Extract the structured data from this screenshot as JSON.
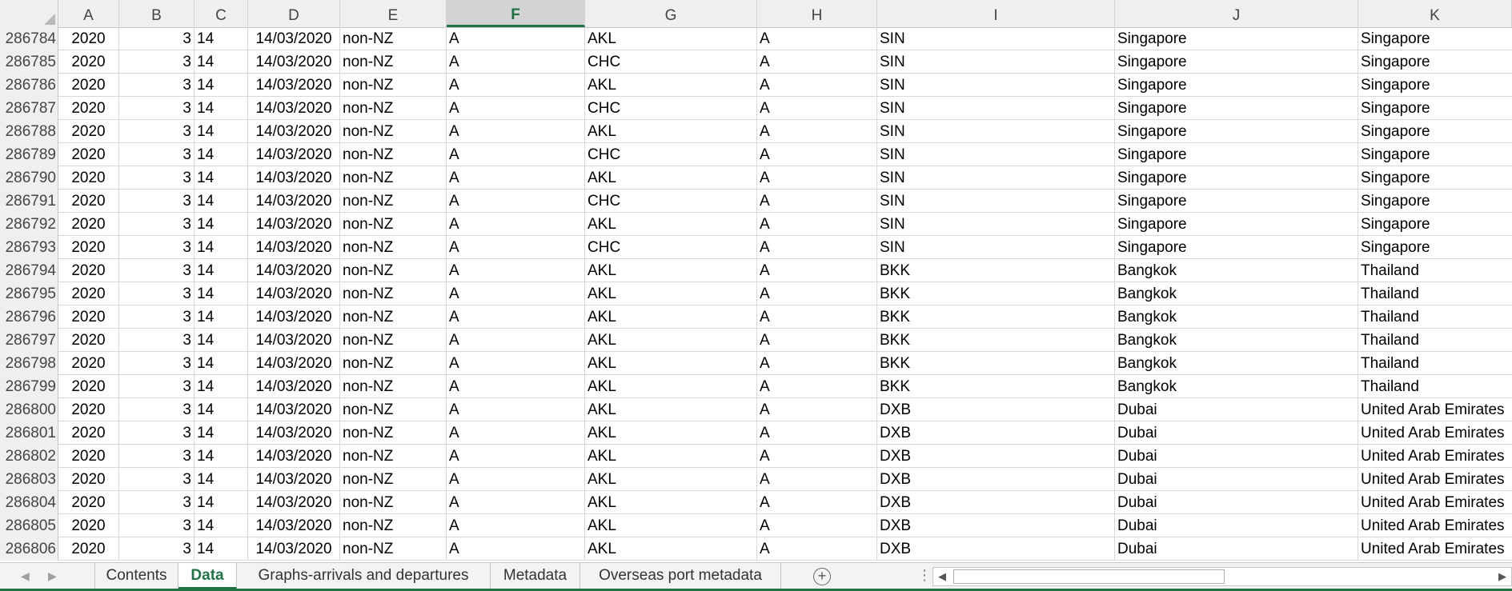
{
  "columns": [
    "A",
    "B",
    "C",
    "D",
    "E",
    "F",
    "G",
    "H",
    "I",
    "J",
    "K"
  ],
  "selected_column": "F",
  "rows": [
    {
      "n": "286784",
      "a": "2020",
      "b": "3",
      "c": "14",
      "d": "14/03/2020",
      "e": "non-NZ",
      "f": "A",
      "g": "AKL",
      "h": "A",
      "i": "SIN",
      "j": "Singapore",
      "k": "Singapore"
    },
    {
      "n": "286785",
      "a": "2020",
      "b": "3",
      "c": "14",
      "d": "14/03/2020",
      "e": "non-NZ",
      "f": "A",
      "g": "CHC",
      "h": "A",
      "i": "SIN",
      "j": "Singapore",
      "k": "Singapore"
    },
    {
      "n": "286786",
      "a": "2020",
      "b": "3",
      "c": "14",
      "d": "14/03/2020",
      "e": "non-NZ",
      "f": "A",
      "g": "AKL",
      "h": "A",
      "i": "SIN",
      "j": "Singapore",
      "k": "Singapore"
    },
    {
      "n": "286787",
      "a": "2020",
      "b": "3",
      "c": "14",
      "d": "14/03/2020",
      "e": "non-NZ",
      "f": "A",
      "g": "CHC",
      "h": "A",
      "i": "SIN",
      "j": "Singapore",
      "k": "Singapore"
    },
    {
      "n": "286788",
      "a": "2020",
      "b": "3",
      "c": "14",
      "d": "14/03/2020",
      "e": "non-NZ",
      "f": "A",
      "g": "AKL",
      "h": "A",
      "i": "SIN",
      "j": "Singapore",
      "k": "Singapore"
    },
    {
      "n": "286789",
      "a": "2020",
      "b": "3",
      "c": "14",
      "d": "14/03/2020",
      "e": "non-NZ",
      "f": "A",
      "g": "CHC",
      "h": "A",
      "i": "SIN",
      "j": "Singapore",
      "k": "Singapore"
    },
    {
      "n": "286790",
      "a": "2020",
      "b": "3",
      "c": "14",
      "d": "14/03/2020",
      "e": "non-NZ",
      "f": "A",
      "g": "AKL",
      "h": "A",
      "i": "SIN",
      "j": "Singapore",
      "k": "Singapore"
    },
    {
      "n": "286791",
      "a": "2020",
      "b": "3",
      "c": "14",
      "d": "14/03/2020",
      "e": "non-NZ",
      "f": "A",
      "g": "CHC",
      "h": "A",
      "i": "SIN",
      "j": "Singapore",
      "k": "Singapore"
    },
    {
      "n": "286792",
      "a": "2020",
      "b": "3",
      "c": "14",
      "d": "14/03/2020",
      "e": "non-NZ",
      "f": "A",
      "g": "AKL",
      "h": "A",
      "i": "SIN",
      "j": "Singapore",
      "k": "Singapore"
    },
    {
      "n": "286793",
      "a": "2020",
      "b": "3",
      "c": "14",
      "d": "14/03/2020",
      "e": "non-NZ",
      "f": "A",
      "g": "CHC",
      "h": "A",
      "i": "SIN",
      "j": "Singapore",
      "k": "Singapore"
    },
    {
      "n": "286794",
      "a": "2020",
      "b": "3",
      "c": "14",
      "d": "14/03/2020",
      "e": "non-NZ",
      "f": "A",
      "g": "AKL",
      "h": "A",
      "i": "BKK",
      "j": "Bangkok",
      "k": "Thailand"
    },
    {
      "n": "286795",
      "a": "2020",
      "b": "3",
      "c": "14",
      "d": "14/03/2020",
      "e": "non-NZ",
      "f": "A",
      "g": "AKL",
      "h": "A",
      "i": "BKK",
      "j": "Bangkok",
      "k": "Thailand"
    },
    {
      "n": "286796",
      "a": "2020",
      "b": "3",
      "c": "14",
      "d": "14/03/2020",
      "e": "non-NZ",
      "f": "A",
      "g": "AKL",
      "h": "A",
      "i": "BKK",
      "j": "Bangkok",
      "k": "Thailand"
    },
    {
      "n": "286797",
      "a": "2020",
      "b": "3",
      "c": "14",
      "d": "14/03/2020",
      "e": "non-NZ",
      "f": "A",
      "g": "AKL",
      "h": "A",
      "i": "BKK",
      "j": "Bangkok",
      "k": "Thailand"
    },
    {
      "n": "286798",
      "a": "2020",
      "b": "3",
      "c": "14",
      "d": "14/03/2020",
      "e": "non-NZ",
      "f": "A",
      "g": "AKL",
      "h": "A",
      "i": "BKK",
      "j": "Bangkok",
      "k": "Thailand"
    },
    {
      "n": "286799",
      "a": "2020",
      "b": "3",
      "c": "14",
      "d": "14/03/2020",
      "e": "non-NZ",
      "f": "A",
      "g": "AKL",
      "h": "A",
      "i": "BKK",
      "j": "Bangkok",
      "k": "Thailand"
    },
    {
      "n": "286800",
      "a": "2020",
      "b": "3",
      "c": "14",
      "d": "14/03/2020",
      "e": "non-NZ",
      "f": "A",
      "g": "AKL",
      "h": "A",
      "i": "DXB",
      "j": "Dubai",
      "k": "United Arab Emirates"
    },
    {
      "n": "286801",
      "a": "2020",
      "b": "3",
      "c": "14",
      "d": "14/03/2020",
      "e": "non-NZ",
      "f": "A",
      "g": "AKL",
      "h": "A",
      "i": "DXB",
      "j": "Dubai",
      "k": "United Arab Emirates"
    },
    {
      "n": "286802",
      "a": "2020",
      "b": "3",
      "c": "14",
      "d": "14/03/2020",
      "e": "non-NZ",
      "f": "A",
      "g": "AKL",
      "h": "A",
      "i": "DXB",
      "j": "Dubai",
      "k": "United Arab Emirates"
    },
    {
      "n": "286803",
      "a": "2020",
      "b": "3",
      "c": "14",
      "d": "14/03/2020",
      "e": "non-NZ",
      "f": "A",
      "g": "AKL",
      "h": "A",
      "i": "DXB",
      "j": "Dubai",
      "k": "United Arab Emirates"
    },
    {
      "n": "286804",
      "a": "2020",
      "b": "3",
      "c": "14",
      "d": "14/03/2020",
      "e": "non-NZ",
      "f": "A",
      "g": "AKL",
      "h": "A",
      "i": "DXB",
      "j": "Dubai",
      "k": "United Arab Emirates"
    },
    {
      "n": "286805",
      "a": "2020",
      "b": "3",
      "c": "14",
      "d": "14/03/2020",
      "e": "non-NZ",
      "f": "A",
      "g": "AKL",
      "h": "A",
      "i": "DXB",
      "j": "Dubai",
      "k": "United Arab Emirates"
    },
    {
      "n": "286806",
      "a": "2020",
      "b": "3",
      "c": "14",
      "d": "14/03/2020",
      "e": "non-NZ",
      "f": "A",
      "g": "AKL",
      "h": "A",
      "i": "DXB",
      "j": "Dubai",
      "k": "United Arab Emirates"
    }
  ],
  "sheet_tabs": [
    "Contents",
    "Data",
    "Graphs-arrivals and departures",
    "Metadata",
    "Overseas port metadata"
  ],
  "active_tab": "Data",
  "icons": {
    "nav_prev": "chevron-left-icon",
    "nav_next": "chevron-right-icon",
    "add_sheet": "plus-circle-icon",
    "options": "vertical-dots-icon",
    "scroll_left": "triangle-left-icon",
    "scroll_right": "triangle-right-icon"
  },
  "glyphs": {
    "prev": "◀",
    "next": "▶",
    "add": "+",
    "dots": "⋮",
    "scroll_left": "◀",
    "scroll_right": "▶"
  },
  "colors": {
    "accent": "#217346",
    "header_bg": "#efefef",
    "gridline": "#d9d9d9"
  }
}
